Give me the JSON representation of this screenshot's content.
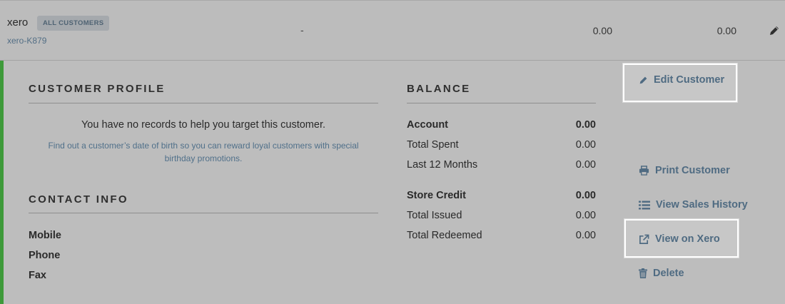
{
  "customer": {
    "name": "xero",
    "group_badge": "ALL CUSTOMERS",
    "code": "xero-K879",
    "col_dash": "-",
    "col_value_1": "0.00",
    "col_value_2": "0.00"
  },
  "profile": {
    "title": "CUSTOMER PROFILE",
    "no_records": "You have no records to help you target this customer.",
    "hint": "Find out a customer’s date of birth so you can reward loyal customers with special birthday promotions."
  },
  "contact": {
    "title": "CONTACT INFO",
    "labels": [
      "Mobile",
      "Phone",
      "Fax"
    ]
  },
  "balance": {
    "title": "BALANCE",
    "account": {
      "label": "Account",
      "value": "0.00"
    },
    "total_spent": {
      "label": "Total Spent",
      "value": "0.00"
    },
    "last_12_months": {
      "label": "Last 12 Months",
      "value": "0.00"
    },
    "store_credit": {
      "label": "Store Credit",
      "value": "0.00"
    },
    "total_issued": {
      "label": "Total Issued",
      "value": "0.00"
    },
    "total_redeemed": {
      "label": "Total Redeemed",
      "value": "0.00"
    }
  },
  "actions": {
    "edit": "Edit Customer",
    "print": "Print Customer",
    "history": "View Sales History",
    "xero": "View on Xero",
    "delete": "Delete"
  },
  "colors": {
    "accent_green": "#3e9a3a",
    "link_blue": "#4f6b82"
  }
}
